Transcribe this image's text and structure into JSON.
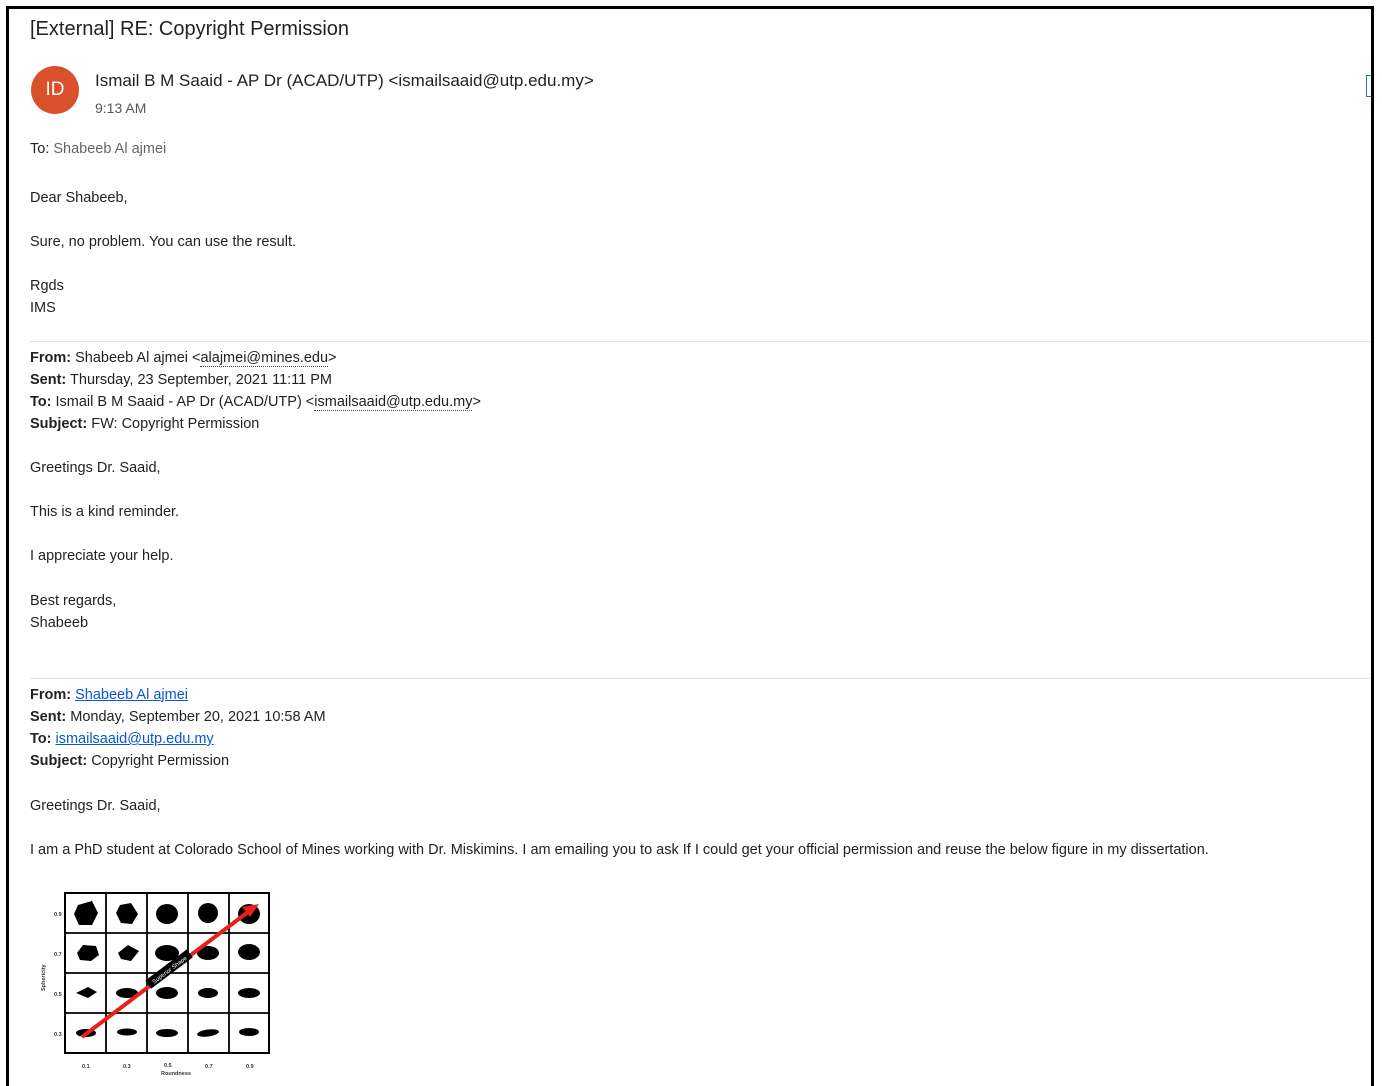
{
  "email": {
    "subject": "[External] RE: Copyright Permission",
    "avatar_initials": "ID",
    "avatar_color": "#d9502b",
    "sender": "Ismail B M Saaid - AP Dr (ACAD/UTP) <ismailsaaid@utp.edu.my>",
    "time": "9:13 AM",
    "to_label": "To:",
    "to_value": "Shabeeb Al ajmei",
    "body": [
      "Dear Shabeeb,",
      "Sure, no problem. You can use the result.",
      "Rgds",
      "IMS"
    ]
  },
  "quote1": {
    "from_label": "From:",
    "from_text": "Shabeeb Al ajmei <",
    "from_email": "alajmei@mines.edu",
    "from_close": ">",
    "sent_label": "Sent:",
    "sent": "Thursday, 23 September, 2021 11:11 PM",
    "to_label": "To:",
    "to_text": "Ismail B M Saaid - AP Dr (ACAD/UTP) <",
    "to_email": "ismailsaaid@utp.edu.my",
    "to_close": ">",
    "subject_label": "Subject:",
    "subject": "FW: Copyright Permission",
    "body": [
      "Greetings Dr. Saaid,",
      "This is a kind reminder.",
      "I appreciate your help.",
      "Best regards,",
      "Shabeeb"
    ]
  },
  "quote2": {
    "from_label": "From:",
    "from_link": "Shabeeb Al ajmei",
    "sent_label": "Sent:",
    "sent": "Monday, September 20, 2021 10:58 AM",
    "to_label": "To:",
    "to_link": "ismailsaaid@utp.edu.my",
    "subject_label": "Subject:",
    "subject": "Copyright Permission",
    "body": [
      "Greetings Dr. Saaid,",
      "I am a PhD student at Colorado School of Mines working with Dr. Miskimins. I am emailing you to ask If I could get your official permission and reuse the below figure in my dissertation."
    ]
  },
  "figure": {
    "ylabel": "Sphericity",
    "xlabel": "Roundness",
    "arrow_label": "Superior Shape",
    "yticks": [
      "0.9",
      "0.7",
      "0.5",
      "0.3"
    ],
    "xticks": [
      "0.1",
      "0.3",
      "0.5",
      "0.7",
      "0.9"
    ],
    "arrow_color": "#e8201a"
  }
}
